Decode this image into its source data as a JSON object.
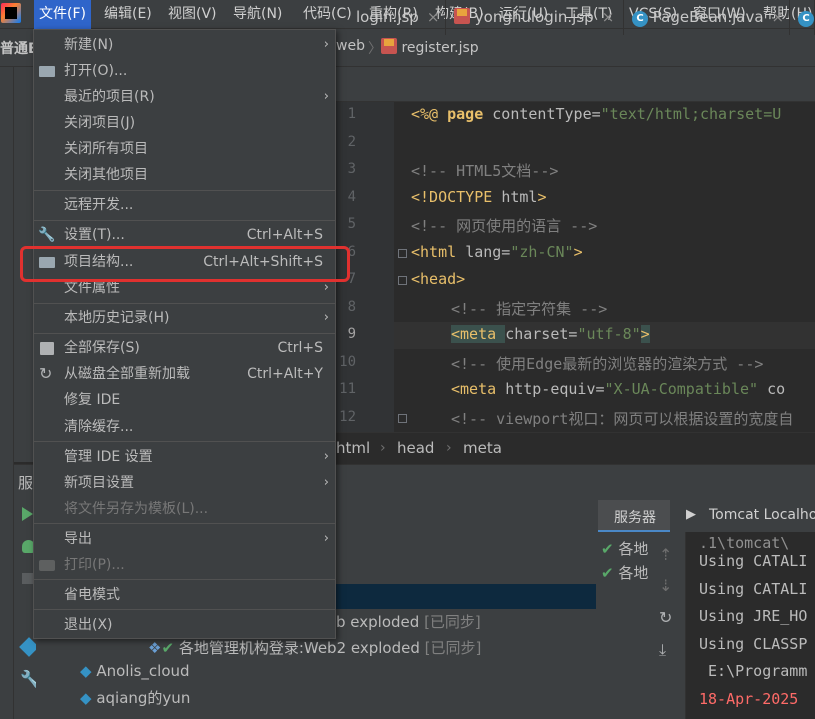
{
  "menubar": {
    "items": [
      "文件(F)",
      "编辑(E)",
      "视图(V)",
      "导航(N)",
      "代码(C)",
      "重构(R)",
      "构建(B)",
      "运行(U)",
      "工具(T)",
      "VCS(S)",
      "窗口(W)",
      "帮助(H)"
    ]
  },
  "navbar": {
    "project": "普通B",
    "folder": "web",
    "file": "register.jsp"
  },
  "tabs": [
    "login.jsp",
    "yonghulogin.jsp",
    "PageBean.java"
  ],
  "editor": {
    "line_numbers": [
      "1",
      "2",
      "3",
      "4",
      "5",
      "6",
      "7",
      "8",
      "9",
      "10",
      "11",
      "12"
    ],
    "lines": {
      "l1a": "<%@ ",
      "l1b": "page ",
      "l1c": "contentType=",
      "l1d": "\"text/html;charset=U",
      "l3": "<!-- HTML5文档-->",
      "l4a": "<!DOCTYPE ",
      "l4b": "html",
      "l4c": ">",
      "l5": "<!-- 网页使用的语言 -->",
      "l6a": "<html ",
      "l6b": "lang=",
      "l6c": "\"zh-CN\"",
      "l6d": ">",
      "l7": "<head>",
      "l8": "<!-- 指定字符集 -->",
      "l9a": "<meta ",
      "l9b": "charset=",
      "l9c": "\"utf-8\"",
      "l9d": ">",
      "l10": "<!-- 使用Edge最新的浏览器的渲染方式 -->",
      "l11a": "<meta ",
      "l11b": "http-equiv=",
      "l11c": "\"X-UA-Compatible\"",
      "l11d": " co",
      "l12": "<!-- viewport视口：网页可以根据设置的宽度自"
    }
  },
  "breadcrumb": [
    "html",
    "head",
    "meta"
  ],
  "services": {
    "title": "服",
    "tab_servers": "服务器",
    "tab_tomcat": "Tomcat Localhost",
    "side_items": [
      "各地",
      "各地"
    ],
    "tree": {
      "row1": "b exploded",
      "row1_tag": "[已同步]",
      "row2": "各地管理机构登录:Web2 exploded",
      "row2_tag": "[已同步]",
      "row3": "Anolis_cloud",
      "row4": "aqiang的yun"
    },
    "console": [
      ".1\\tomcat\\",
      "Using CATALI",
      "Using CATALI",
      "Using JRE_HO",
      "Using CLASSP",
      " E:\\Programm",
      "18-Apr-2025"
    ]
  },
  "file_menu": {
    "items": [
      {
        "label": "新建(N)",
        "arrow": "›"
      },
      {
        "label": "打开(O)..."
      },
      {
        "label": "最近的项目(R)",
        "arrow": "›"
      },
      {
        "label": "关闭项目(J)"
      },
      {
        "label": "关闭所有项目"
      },
      {
        "label": "关闭其他项目"
      },
      {
        "label": "远程开发..."
      },
      {
        "label": "设置(T)...",
        "shortcut": "Ctrl+Alt+S"
      },
      {
        "label": "项目结构...",
        "shortcut": "Ctrl+Alt+Shift+S"
      },
      {
        "label": "文件属性",
        "arrow": "›"
      },
      {
        "label": "本地历史记录(H)",
        "arrow": "›"
      },
      {
        "label": "全部保存(S)",
        "shortcut": "Ctrl+S"
      },
      {
        "label": "从磁盘全部重新加载",
        "shortcut": "Ctrl+Alt+Y"
      },
      {
        "label": "修复 IDE"
      },
      {
        "label": "清除缓存..."
      },
      {
        "label": "管理 IDE 设置",
        "arrow": "›"
      },
      {
        "label": "新项目设置",
        "arrow": "›"
      },
      {
        "label": "将文件另存为模板(L)..."
      },
      {
        "label": "导出",
        "arrow": "›"
      },
      {
        "label": "打印(P)..."
      },
      {
        "label": "省电模式"
      },
      {
        "label": "退出(X)"
      }
    ]
  },
  "colors": {
    "accent": "#2f65ca",
    "highlight_box": "#e0312f"
  }
}
